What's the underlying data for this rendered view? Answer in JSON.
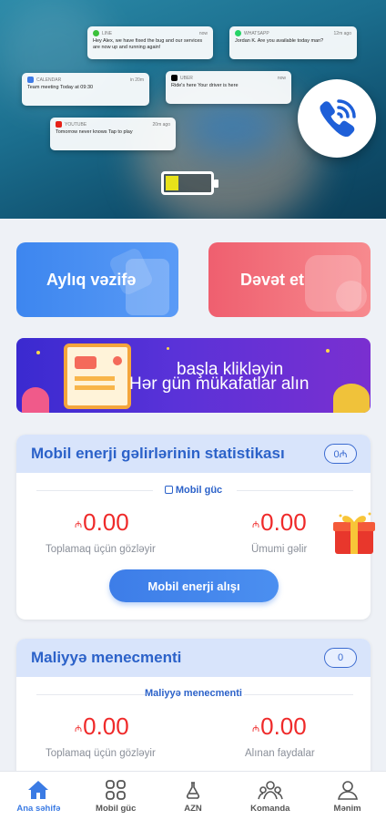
{
  "hero": {
    "notifications": [
      {
        "app": "LINE",
        "time": "now",
        "body": "Hey Alex, we have fixed the bug and our services are now up and running again!"
      },
      {
        "app": "WHATSAPP",
        "time": "12m ago",
        "body": "Jordan K. Are you available today man?"
      },
      {
        "app": "CALENDAR",
        "time": "in 20m",
        "body": "Team meeting Today at 09:30"
      },
      {
        "app": "UBER",
        "time": "now",
        "body": "Ride's here Your driver is here"
      },
      {
        "app": "YOUTUBE",
        "time": "20m ago",
        "body": "Tomorrow never knows Tap to play"
      }
    ],
    "battery_level": 0.3
  },
  "actions": {
    "monthly_task": "Aylıq vəzifə",
    "invite": "Dəvət et"
  },
  "banner": {
    "line1": "başla klikləyin",
    "line2": "Hər gün mükafatlar alın"
  },
  "energy_card": {
    "title": "Mobil enerji gəlirlərinin statistikası",
    "pill": "0₼",
    "subtitle": "Mobil güc",
    "currency": "₼",
    "left_value": "0.00",
    "left_label": "Toplamaq üçün gözləyir",
    "right_value": "0.00",
    "right_label": "Ümumi gəlir",
    "button": "Mobil enerji alışı"
  },
  "finance_card": {
    "title": "Maliyyə menecmenti",
    "pill": "0",
    "subtitle": "Maliyyə menecmenti",
    "currency": "₼",
    "left_value": "0.00",
    "left_label": "Toplamaq üçün gözləyir",
    "right_value": "0.00",
    "right_label": "Alınan faydalar"
  },
  "nav": [
    {
      "label": "Ana səhifə",
      "icon": "home-icon",
      "active": true
    },
    {
      "label": "Mobil güc",
      "icon": "grid-icon",
      "active": false
    },
    {
      "label": "AZN",
      "icon": "flask-icon",
      "active": false
    },
    {
      "label": "Komanda",
      "icon": "team-icon",
      "active": false
    },
    {
      "label": "Mənim",
      "icon": "user-icon",
      "active": false
    }
  ],
  "colors": {
    "accent": "#3b7be4",
    "value_red": "#ef2a2a",
    "invite_red": "#ef5f6f"
  }
}
